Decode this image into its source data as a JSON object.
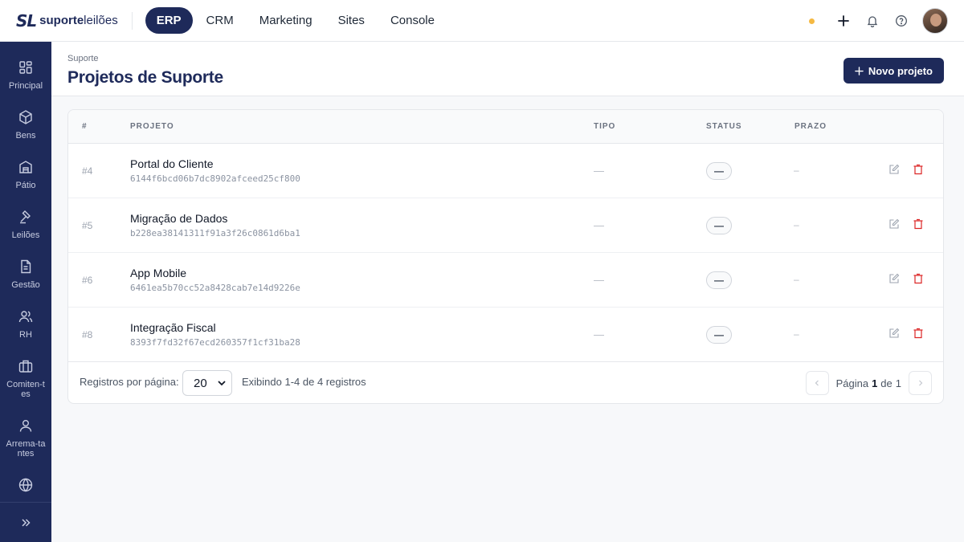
{
  "brand": {
    "mark": "SL",
    "name_bold": "suporte",
    "name_light": "leilões"
  },
  "topnav": [
    {
      "label": "ERP",
      "active": true
    },
    {
      "label": "CRM",
      "active": false
    },
    {
      "label": "Marketing",
      "active": false
    },
    {
      "label": "Sites",
      "active": false
    },
    {
      "label": "Console",
      "active": false
    }
  ],
  "topbar_icons": [
    "status-dot",
    "plus-icon",
    "bell-icon",
    "help-icon",
    "avatar"
  ],
  "sidebar": [
    {
      "label": "Principal",
      "icon": "grid-icon"
    },
    {
      "label": "Bens",
      "icon": "box-icon"
    },
    {
      "label": "Pátio",
      "icon": "warehouse-icon"
    },
    {
      "label": "Leilões",
      "icon": "gavel-icon"
    },
    {
      "label": "Gestão",
      "icon": "document-icon"
    },
    {
      "label": "RH",
      "icon": "users-icon"
    },
    {
      "label": "Comiten-tes",
      "icon": "briefcase-icon"
    },
    {
      "label": "Arrema-tantes",
      "icon": "user-icon"
    },
    {
      "label": "",
      "icon": "globe-icon"
    }
  ],
  "header": {
    "breadcrumb": "Suporte",
    "title": "Projetos de Suporte",
    "new_button": "Novo projeto"
  },
  "table": {
    "columns": [
      "#",
      "PROJETO",
      "TIPO",
      "STATUS",
      "PRAZO"
    ],
    "rows": [
      {
        "id": "#4",
        "name": "Portal do Cliente",
        "hash": "6144f6bcd06b7dc8902afceed25cf800",
        "tipo": "—",
        "status": "—",
        "prazo": "–"
      },
      {
        "id": "#5",
        "name": "Migração de Dados",
        "hash": "b228ea38141311f91a3f26c0861d6ba1",
        "tipo": "—",
        "status": "—",
        "prazo": "–"
      },
      {
        "id": "#6",
        "name": "App Mobile",
        "hash": "6461ea5b70cc52a8428cab7e14d9226e",
        "tipo": "—",
        "status": "—",
        "prazo": "–"
      },
      {
        "id": "#8",
        "name": "Integração Fiscal",
        "hash": "8393f7fd32f67ecd260357f1cf31ba28",
        "tipo": "—",
        "status": "—",
        "prazo": "–"
      }
    ]
  },
  "footer": {
    "rpp_label": "Registros por página:",
    "rpp_value": "20",
    "showing": "Exibindo 1-4 de 4 registros",
    "page_label": "Página",
    "page_current": "1",
    "page_of": "de",
    "page_total": "1"
  },
  "colors": {
    "brand": "#1e2a5a",
    "danger": "#dc2626",
    "status_dot": "#f5b942"
  }
}
